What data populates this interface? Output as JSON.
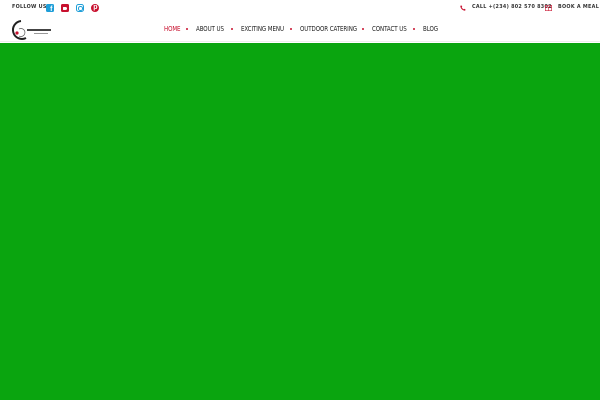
{
  "topbar": {
    "follow_label": "FOLLOW US",
    "social": [
      {
        "icon": "facebook-icon",
        "color": "#1e9ed8"
      },
      {
        "icon": "twitter-icon",
        "color": "#c8102e"
      },
      {
        "icon": "instagram-icon",
        "color": "#1e9ed8"
      },
      {
        "icon": "pinterest-icon",
        "color": "#c8102e"
      }
    ],
    "call_label": "CALL +(234) 802 570 8302",
    "book_label": "BOOK A MEAL"
  },
  "nav": {
    "items": [
      {
        "label": "HOME",
        "active": true
      },
      {
        "label": "ABOUT US",
        "active": false
      },
      {
        "label": "EXCITING MENU",
        "active": false
      },
      {
        "label": "OUTDOOR CATERING",
        "active": false
      },
      {
        "label": "CONTACT US",
        "active": false
      },
      {
        "label": "BLOG",
        "active": false
      }
    ]
  },
  "colors": {
    "accent": "#c8102e",
    "social_blue": "#1e9ed8",
    "hero_green": "#0aa50f",
    "text": "#222222"
  }
}
